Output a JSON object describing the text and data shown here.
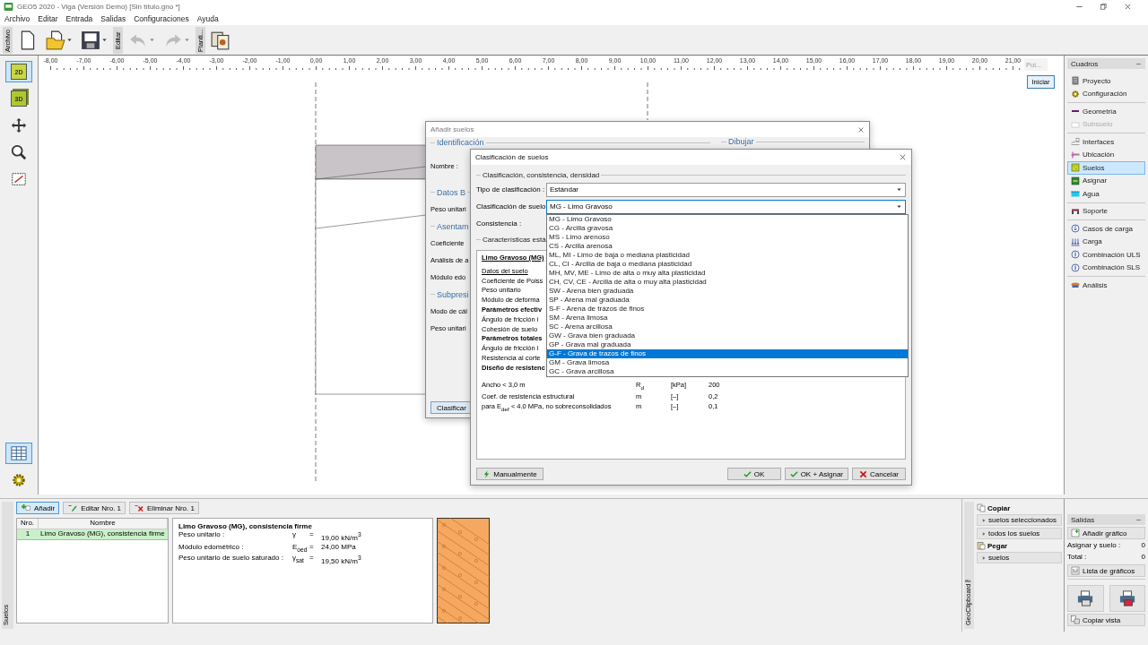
{
  "window": {
    "title": "GEO5 2020 - Viga (Versión Demo) [Sin título.gno *]"
  },
  "menu": [
    "Archivo",
    "Editar",
    "Entrada",
    "Salidas",
    "Configuraciones",
    "Ayuda"
  ],
  "toolbar": [
    {
      "label": "Archivo",
      "tools": [
        {
          "kind": "new",
          "disabled": false,
          "dropdown": false
        },
        {
          "kind": "open",
          "disabled": false,
          "dropdown": true
        },
        {
          "kind": "save",
          "disabled": false,
          "dropdown": true
        }
      ]
    },
    {
      "label": "Editar",
      "tools": [
        {
          "kind": "undo",
          "disabled": true,
          "dropdown": true
        },
        {
          "kind": "redo",
          "disabled": true,
          "dropdown": true
        }
      ]
    },
    {
      "label": "Planti...",
      "tools": [
        {
          "kind": "template",
          "disabled": false,
          "dropdown": false
        }
      ]
    }
  ],
  "view_tools": [
    {
      "kind": "plane",
      "label": "2D",
      "selected": true
    },
    {
      "kind": "cube",
      "label": "3D",
      "selected": false
    },
    {
      "kind": "move",
      "selected": false
    },
    {
      "kind": "zoom",
      "selected": false
    },
    {
      "kind": "fit",
      "selected": false
    }
  ],
  "lower_tools": [
    {
      "kind": "table",
      "selected": true
    },
    {
      "kind": "settings",
      "selected": false
    }
  ],
  "ruler": {
    "labels": [
      "-8,00",
      "-7,00",
      "-6,00",
      "-5,00",
      "-4,00",
      "-3,00",
      "-2,00",
      "-1,00",
      "0,00",
      "1,00",
      "2,00",
      "3,00",
      "4,00",
      "5,00",
      "6,00",
      "7,00",
      "8,00",
      "9,00",
      "10,00",
      "11,00",
      "12,00",
      "13,00",
      "14,00",
      "15,00",
      "16,00",
      "17,00",
      "18,00",
      "19,00",
      "20,00",
      "21,00"
    ],
    "point_field": {
      "placeholder": "Poi..."
    },
    "start_button": "Iniciar"
  },
  "cuadros": {
    "title": "Cuadros",
    "groups": [
      {
        "items": [
          {
            "label": "Proyecto",
            "kind": "project",
            "selected": false,
            "disabled": false
          },
          {
            "label": "Configuración",
            "kind": "settings",
            "selected": false,
            "disabled": false
          }
        ]
      },
      {
        "items": [
          {
            "label": "Geometría",
            "kind": "line",
            "selected": false,
            "disabled": false
          },
          {
            "label": "Subsuelo",
            "kind": "box",
            "selected": false,
            "disabled": true
          }
        ]
      },
      {
        "items": [
          {
            "label": "Interfaces",
            "kind": "interfaces",
            "selected": false,
            "disabled": false
          },
          {
            "label": "Ubicación",
            "kind": "location",
            "selected": false,
            "disabled": false
          },
          {
            "label": "Suelos",
            "kind": "soils",
            "selected": true,
            "disabled": false
          },
          {
            "label": "Asignar",
            "kind": "assign",
            "selected": false,
            "disabled": false
          },
          {
            "label": "Agua",
            "kind": "water",
            "selected": false,
            "disabled": false
          }
        ]
      },
      {
        "items": [
          {
            "label": "Soporte",
            "kind": "support",
            "selected": false,
            "disabled": false
          }
        ]
      },
      {
        "items": [
          {
            "label": "Casos de carga",
            "kind": "loadcases",
            "selected": false,
            "disabled": false
          },
          {
            "label": "Carga",
            "kind": "load",
            "selected": false,
            "disabled": false
          },
          {
            "label": "Combinación ULS",
            "kind": "combo",
            "selected": false,
            "disabled": false
          },
          {
            "label": "Combinación SLS",
            "kind": "combo",
            "selected": false,
            "disabled": false
          }
        ]
      },
      {
        "items": [
          {
            "label": "Análisis",
            "kind": "analysis",
            "selected": false,
            "disabled": false
          }
        ]
      }
    ]
  },
  "add_soil_dialog": {
    "title": "Añadir suelos",
    "rows": [
      {
        "kind": "group",
        "text": "Identificación"
      },
      {
        "kind": "label",
        "text": "Nombre :"
      },
      {
        "kind": "group",
        "text": "Datos B"
      },
      {
        "kind": "label",
        "text": "Peso unitari"
      },
      {
        "kind": "group",
        "text": "Asentam"
      },
      {
        "kind": "label",
        "text": "Coeficiente"
      },
      {
        "kind": "label",
        "text": "Análisis de a"
      },
      {
        "kind": "label",
        "text": "Módulo edo"
      },
      {
        "kind": "group",
        "text": "Subpresi"
      },
      {
        "kind": "label",
        "text": "Modo de cál"
      },
      {
        "kind": "label",
        "text": "Peso unitari"
      }
    ],
    "right_group": "Dibujar",
    "button": "Clasificar"
  },
  "classification_dialog": {
    "title": "Clasificación de suelos",
    "group": "Clasificación, consistencia, densidad",
    "type_label": "Tipo de clasificación :",
    "type_value": "Estándar",
    "class_label": "Clasificación de suelo",
    "class_value": "MG - Limo Gravoso",
    "open": true,
    "options": [
      {
        "label": "MG - Limo Gravoso",
        "selected": false
      },
      {
        "label": "CG - Arcilla gravosa",
        "selected": false
      },
      {
        "label": "MS - Limo arenoso",
        "selected": false
      },
      {
        "label": "CS - Arcilla arenosa",
        "selected": false
      },
      {
        "label": "ML, MI - Limo de baja o mediana plasticidad",
        "selected": false
      },
      {
        "label": "CL, CI - Arcilla de baja o mediana plasticidad",
        "selected": false
      },
      {
        "label": "MH, MV, ME - Limo de alta o muy alta plasticidad",
        "selected": false
      },
      {
        "label": "CH, CV, CE - Arcilla de alta o muy alta plasticidad",
        "selected": false
      },
      {
        "label": "SW - Arena bien graduada",
        "selected": false
      },
      {
        "label": "SP - Arena mal graduada",
        "selected": false
      },
      {
        "label": "S-F - Arena de trazos de finos",
        "selected": false
      },
      {
        "label": "SM - Arena limosa",
        "selected": false
      },
      {
        "label": "SC - Arena arcillosa",
        "selected": false
      },
      {
        "label": "GW - Grava bien graduada",
        "selected": false
      },
      {
        "label": "GP - Grava mal graduada",
        "selected": false
      },
      {
        "label": "G-F - Grava de trazos de finos",
        "selected": true
      },
      {
        "label": "GM - Grava limosa",
        "selected": false
      },
      {
        "label": "GC - Grava arcillosa",
        "selected": false
      }
    ],
    "consistency_label": "Consistencia :",
    "characteristics_group": "Características está",
    "details": [
      {
        "kind": "title",
        "text": "Limo Gravoso (MG)"
      },
      {
        "kind": "link",
        "text": "Datos del suelo"
      },
      {
        "kind": "plain",
        "text": "Coeficiente de Poiss"
      },
      {
        "kind": "plain",
        "text": "Peso unitario"
      },
      {
        "kind": "plain",
        "text": "Módulo de deforma"
      },
      {
        "kind": "bold",
        "text": "Parámetros efectiv"
      },
      {
        "kind": "plain",
        "text": "Ángulo de fricción i"
      },
      {
        "kind": "plain",
        "text": "Cohesión de suelo"
      },
      {
        "kind": "bold",
        "text": "Parámetros totales"
      },
      {
        "kind": "plain",
        "text": "Ángulo de fricción i"
      },
      {
        "kind": "plain",
        "text": "Resistencia al corte"
      },
      {
        "kind": "bold",
        "text": "Diseño de resistenc"
      },
      {
        "kind": "plain",
        "text": "Ancho < 3,0 m",
        "symbol": "R$_{d}$",
        "unit": "[kPa]",
        "value": "200"
      },
      {
        "kind": "plain",
        "text": "Coef. de resistencia estructural",
        "symbol": "m",
        "unit": "[–]",
        "value": "0,2"
      },
      {
        "kind": "plain",
        "text": "para E$_{def}$ < 4.0 MPa, no sobreconsolidados",
        "symbol": "m",
        "unit": "[–]",
        "value": "0,1"
      }
    ],
    "buttons": [
      {
        "kind": "manual",
        "label": "Manualmente"
      },
      {
        "kind": "ok",
        "label": "OK"
      },
      {
        "kind": "ok",
        "label": "OK + Asignar"
      },
      {
        "kind": "cancel",
        "label": "Cancelar"
      }
    ]
  },
  "soils": {
    "tab": "Suelos",
    "actions": [
      {
        "kind": "add",
        "label": "Añadir",
        "selected": true
      },
      {
        "kind": "edit",
        "label": "Editar Nro. 1",
        "selected": false
      },
      {
        "kind": "delete",
        "label": "Eliminar Nro. 1",
        "selected": false
      }
    ],
    "table": {
      "columns": [
        "Nro.",
        "Nombre"
      ],
      "rows": [
        {
          "cells": [
            "1",
            "Limo Gravoso (MG), consistencia firme"
          ],
          "selected": true
        }
      ]
    },
    "info": {
      "title": "Limo Gravoso (MG), consistencia firme",
      "rows": [
        {
          "label": "Peso unitario :",
          "symbol": "γ",
          "equals": "=",
          "value": "19,00 kN/m$^{3}$"
        },
        {
          "label": "Módulo edométrico :",
          "symbol": "E$_{oed}$",
          "equals": "=",
          "value": "24,00 MPa"
        },
        {
          "label": "Peso unitario de suelo saturado :",
          "symbol": "γ$_{sat}$",
          "equals": "=",
          "value": "19,50 kN/m$^{3}$"
        }
      ]
    }
  },
  "clipboard": {
    "tab": "GeoClipboard™",
    "sections": [
      {
        "kind": "copy",
        "title": "Copiar",
        "buttons": [
          "suelos seleccionados",
          "todos los suelos"
        ]
      },
      {
        "kind": "paste",
        "title": "Pegar",
        "buttons": [
          "suelos"
        ]
      }
    ]
  },
  "salidas": {
    "title": "Salidas",
    "add_button": "Añadir gráfico",
    "counts": [
      {
        "label": "Asignar y suelo :",
        "value": "0"
      },
      {
        "label": "Total :",
        "value": "0"
      }
    ],
    "list_button": "Lista de gráficos",
    "copy_button": "Copiar vista"
  }
}
